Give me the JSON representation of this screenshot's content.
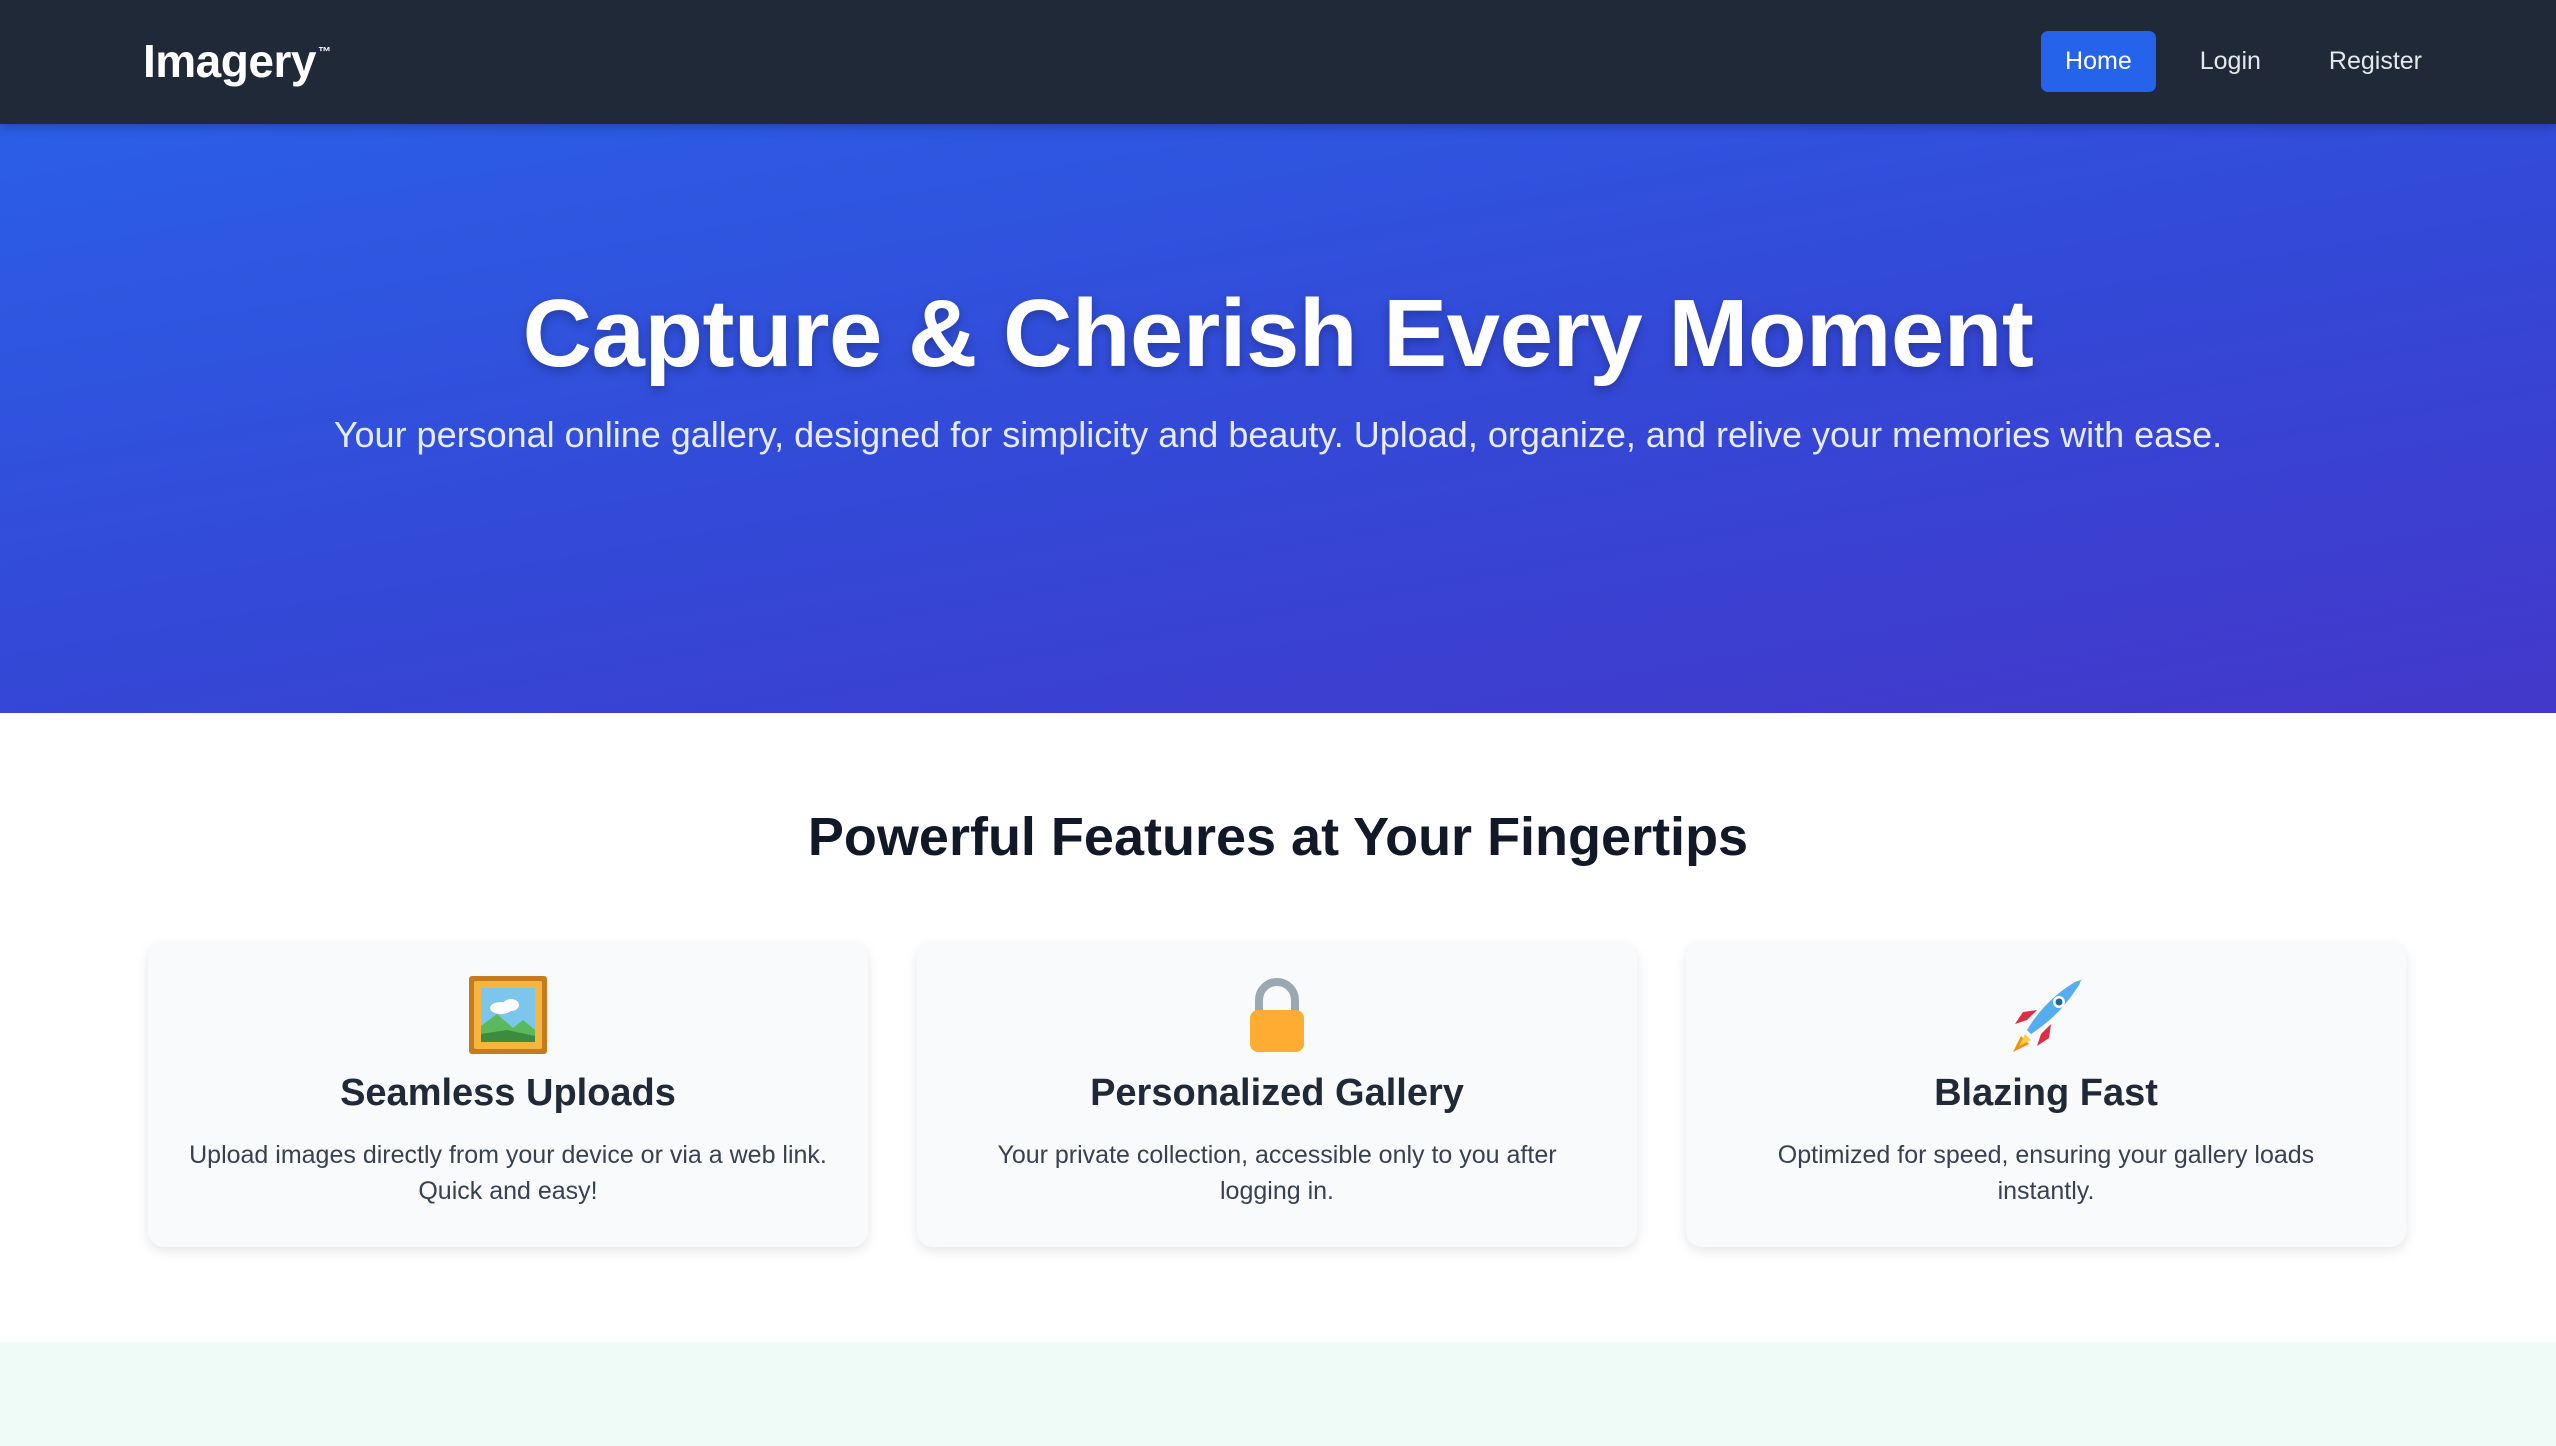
{
  "navbar": {
    "brand": "Imagery",
    "brand_mark": "™",
    "links": [
      {
        "label": "Home",
        "active": true
      },
      {
        "label": "Login",
        "active": false
      },
      {
        "label": "Register",
        "active": false
      }
    ]
  },
  "hero": {
    "title": "Capture & Cherish Every Moment",
    "subtitle": "Your personal online gallery, designed for simplicity and beauty. Upload, organize, and relive your memories with ease."
  },
  "features": {
    "title": "Powerful Features at Your Fingertips",
    "cards": [
      {
        "icon": "framed-picture-icon",
        "title": "Seamless Uploads",
        "description": "Upload images directly from your device or via a web link. Quick and easy!"
      },
      {
        "icon": "lock-icon",
        "title": "Personalized Gallery",
        "description": "Your private collection, accessible only to you after logging in."
      },
      {
        "icon": "rocket-icon",
        "title": "Blazing Fast",
        "description": "Optimized for speed, ensuring your gallery loads instantly."
      }
    ]
  },
  "colors": {
    "navbar_bg": "#1f2937",
    "accent": "#2563eb",
    "hero_gradient_start": "#2b5fe6",
    "hero_gradient_end": "#4338ca",
    "card_bg": "#f8fafc",
    "bottom_band_bg": "#effbf7"
  }
}
